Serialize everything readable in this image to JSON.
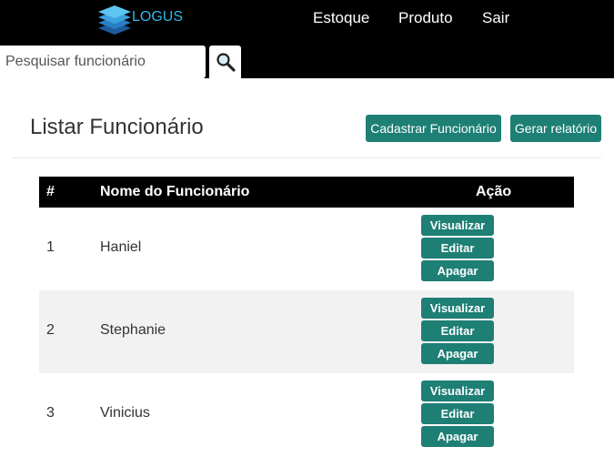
{
  "brand": {
    "logo_text": "LOGUS",
    "logo_color": "#33b6e6"
  },
  "nav": {
    "items": [
      {
        "label": "Estoque"
      },
      {
        "label": "Produto"
      },
      {
        "label": "Sair"
      }
    ]
  },
  "search": {
    "placeholder": "Pesquisar funcionário",
    "value": "",
    "icon": "search-icon"
  },
  "page": {
    "title": "Listar Funcionário",
    "register_button": "Cadastrar Funcionário",
    "report_button": "Gerar relatório"
  },
  "table": {
    "columns": [
      "#",
      "Nome do Funcionário",
      "Ação"
    ],
    "rows": [
      {
        "id": "1",
        "name": "Haniel"
      },
      {
        "id": "2",
        "name": "Stephanie"
      },
      {
        "id": "3",
        "name": "Vinicius"
      }
    ],
    "actions": {
      "view": "Visualizar",
      "edit": "Editar",
      "delete": "Apagar"
    }
  },
  "colors": {
    "accent": "#1e7f75",
    "header_bg": "#000000",
    "stripe": "#f2f2f2"
  }
}
